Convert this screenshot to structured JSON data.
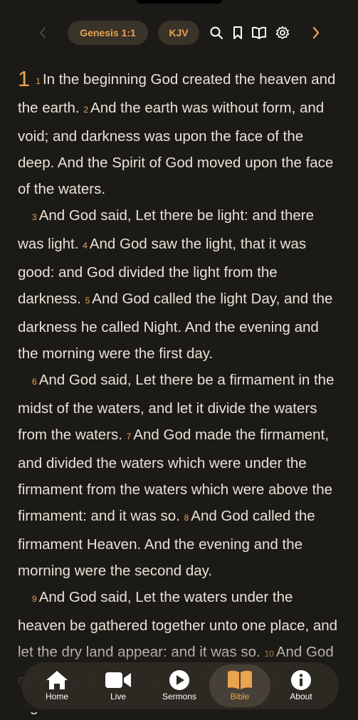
{
  "toolbar": {
    "reference": "Genesis 1:1",
    "version": "KJV",
    "icons": [
      "chevron-left-icon",
      "search-icon",
      "bookmark-icon",
      "book-open-icon",
      "gear-icon",
      "chevron-right-icon"
    ]
  },
  "reader": {
    "chapter": "1",
    "paragraphs": [
      [
        {
          "n": "1",
          "t": "In the beginning God created the heaven and the earth."
        },
        {
          "n": "2",
          "t": "And the earth was without form, and void; and darkness was upon the face of the deep. And the Spirit of God moved upon the face of the waters."
        }
      ],
      [
        {
          "n": "3",
          "t": "And God said, Let there be light: and there was light."
        },
        {
          "n": "4",
          "t": "And God saw the light, that it was good: and God divided the light from the darkness."
        },
        {
          "n": "5",
          "t": "And God called the light Day, and the darkness he called Night. And the evening and the morning were the first day."
        }
      ],
      [
        {
          "n": "6",
          "t": "And God said, Let there be a firmament in the midst of the waters, and let it divide the waters from the waters."
        },
        {
          "n": "7",
          "t": "And God made the firmament, and divided the waters which were under the firmament from the waters which were above the firmament: and it was so."
        },
        {
          "n": "8",
          "t": "And God called the firmament Heaven. And the evening and the morning were the second day."
        }
      ],
      [
        {
          "n": "9",
          "t": "And God said, Let the waters under the heaven be gathered together unto one place, and let the dry land appear: and it was so."
        },
        {
          "n": "10",
          "t": "And God called the dry land Earth; and the gathering together of the waters called he Seas:"
        }
      ]
    ]
  },
  "tabs": [
    {
      "label": "Home",
      "icon": "home-icon"
    },
    {
      "label": "Live",
      "icon": "video-camera-icon"
    },
    {
      "label": "Sermons",
      "icon": "play-circle-icon"
    },
    {
      "label": "Bible",
      "icon": "book-open-icon",
      "active": true
    },
    {
      "label": "About",
      "icon": "info-circle-icon"
    }
  ],
  "colors": {
    "accent": "#e9a44d",
    "background": "#1c1a17",
    "text": "#e8e2d6",
    "pill": "#3a332a"
  }
}
